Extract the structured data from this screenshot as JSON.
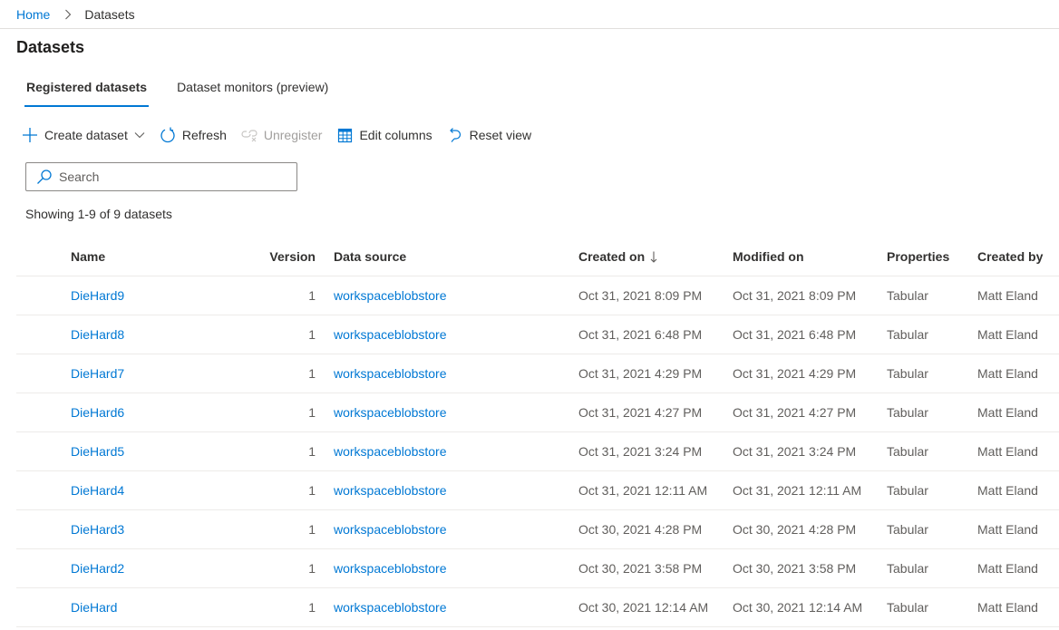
{
  "breadcrumb": {
    "home": "Home",
    "current": "Datasets"
  },
  "page": {
    "title": "Datasets"
  },
  "tabs": [
    {
      "label": "Registered datasets",
      "active": true
    },
    {
      "label": "Dataset monitors (preview)",
      "active": false
    }
  ],
  "toolbar": {
    "create": {
      "label": "Create dataset",
      "icon": "plus-icon"
    },
    "refresh": {
      "label": "Refresh",
      "icon": "refresh-icon"
    },
    "unregister": {
      "label": "Unregister",
      "icon": "unlink-icon",
      "disabled": true
    },
    "edit_columns": {
      "label": "Edit columns",
      "icon": "table-icon"
    },
    "reset_view": {
      "label": "Reset view",
      "icon": "undo-icon"
    }
  },
  "search": {
    "placeholder": "Search",
    "value": ""
  },
  "summary": "Showing 1-9 of 9 datasets",
  "table": {
    "columns": {
      "name": "Name",
      "version": "Version",
      "source": "Data source",
      "created": "Created on",
      "modified": "Modified on",
      "properties": "Properties",
      "created_by": "Created by"
    },
    "sort": {
      "column": "created",
      "direction": "descending"
    },
    "rows": [
      {
        "name": "DieHard9",
        "version": "1",
        "source": "workspaceblobstore",
        "created": "Oct 31, 2021 8:09 PM",
        "modified": "Oct 31, 2021 8:09 PM",
        "properties": "Tabular",
        "created_by": "Matt Eland"
      },
      {
        "name": "DieHard8",
        "version": "1",
        "source": "workspaceblobstore",
        "created": "Oct 31, 2021 6:48 PM",
        "modified": "Oct 31, 2021 6:48 PM",
        "properties": "Tabular",
        "created_by": "Matt Eland"
      },
      {
        "name": "DieHard7",
        "version": "1",
        "source": "workspaceblobstore",
        "created": "Oct 31, 2021 4:29 PM",
        "modified": "Oct 31, 2021 4:29 PM",
        "properties": "Tabular",
        "created_by": "Matt Eland"
      },
      {
        "name": "DieHard6",
        "version": "1",
        "source": "workspaceblobstore",
        "created": "Oct 31, 2021 4:27 PM",
        "modified": "Oct 31, 2021 4:27 PM",
        "properties": "Tabular",
        "created_by": "Matt Eland"
      },
      {
        "name": "DieHard5",
        "version": "1",
        "source": "workspaceblobstore",
        "created": "Oct 31, 2021 3:24 PM",
        "modified": "Oct 31, 2021 3:24 PM",
        "properties": "Tabular",
        "created_by": "Matt Eland"
      },
      {
        "name": "DieHard4",
        "version": "1",
        "source": "workspaceblobstore",
        "created": "Oct 31, 2021 12:11 AM",
        "modified": "Oct 31, 2021 12:11 AM",
        "properties": "Tabular",
        "created_by": "Matt Eland"
      },
      {
        "name": "DieHard3",
        "version": "1",
        "source": "workspaceblobstore",
        "created": "Oct 30, 2021 4:28 PM",
        "modified": "Oct 30, 2021 4:28 PM",
        "properties": "Tabular",
        "created_by": "Matt Eland"
      },
      {
        "name": "DieHard2",
        "version": "1",
        "source": "workspaceblobstore",
        "created": "Oct 30, 2021 3:58 PM",
        "modified": "Oct 30, 2021 3:58 PM",
        "properties": "Tabular",
        "created_by": "Matt Eland"
      },
      {
        "name": "DieHard",
        "version": "1",
        "source": "workspaceblobstore",
        "created": "Oct 30, 2021 12:14 AM",
        "modified": "Oct 30, 2021 12:14 AM",
        "properties": "Tabular",
        "created_by": "Matt Eland"
      }
    ]
  },
  "colors": {
    "accent": "#0078d4",
    "text": "#323130",
    "secondary_text": "#605e5c",
    "disabled": "#a19f9d",
    "divider": "#edebe9"
  }
}
